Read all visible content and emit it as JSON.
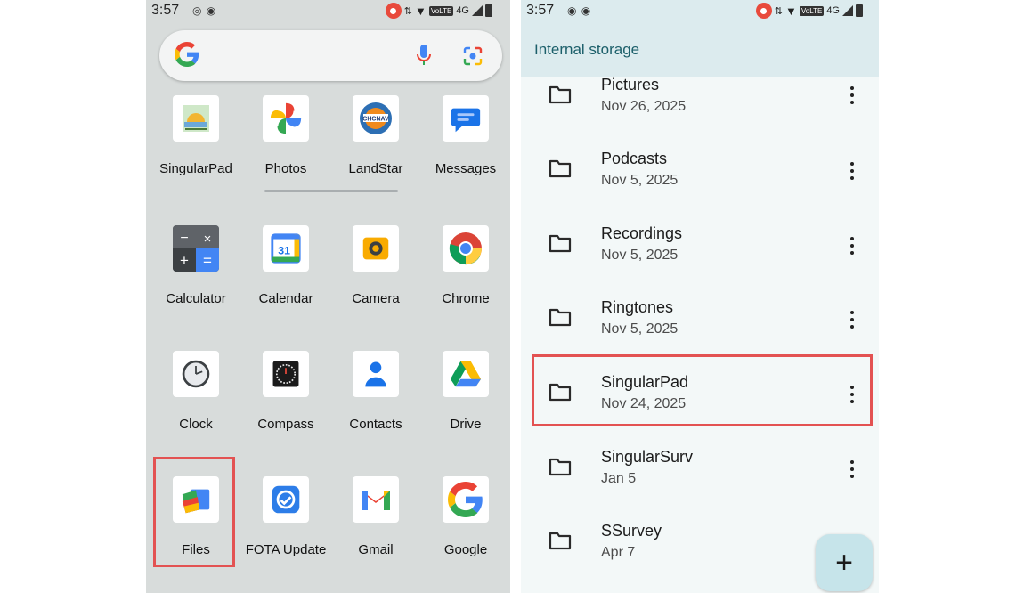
{
  "left_screen": {
    "status_time": "3:57",
    "network": "4G",
    "volte": "VoLTE",
    "apps": [
      {
        "label": "SingularPad",
        "icon": "singularpad-icon"
      },
      {
        "label": "Photos",
        "icon": "photos-icon"
      },
      {
        "label": "LandStar",
        "icon": "landstar-icon"
      },
      {
        "label": "Messages",
        "icon": "messages-icon"
      },
      {
        "label": "Calculator",
        "icon": "calculator-icon"
      },
      {
        "label": "Calendar",
        "icon": "calendar-icon"
      },
      {
        "label": "Camera",
        "icon": "camera-icon"
      },
      {
        "label": "Chrome",
        "icon": "chrome-icon"
      },
      {
        "label": "Clock",
        "icon": "clock-icon"
      },
      {
        "label": "Compass",
        "icon": "compass-icon"
      },
      {
        "label": "Contacts",
        "icon": "contacts-icon"
      },
      {
        "label": "Drive",
        "icon": "drive-icon"
      },
      {
        "label": "Files",
        "icon": "files-icon"
      },
      {
        "label": "FOTA Update",
        "icon": "fota-update-icon"
      },
      {
        "label": "Gmail",
        "icon": "gmail-icon"
      },
      {
        "label": "Google",
        "icon": "google-icon"
      }
    ],
    "calendar_day": "31",
    "landstar_badge": "CHCNAV",
    "highlight_color": "#e35252"
  },
  "right_screen": {
    "status_time": "3:57",
    "network": "4G",
    "volte": "VoLTE",
    "title": "Internal storage",
    "folders": [
      {
        "name": "Pictures",
        "date": "Nov 26, 2025"
      },
      {
        "name": "Podcasts",
        "date": "Nov 5, 2025"
      },
      {
        "name": "Recordings",
        "date": "Nov 5, 2025"
      },
      {
        "name": "Ringtones",
        "date": "Nov 5, 2025"
      },
      {
        "name": "SingularPad",
        "date": "Nov 24, 2025"
      },
      {
        "name": "SingularSurv",
        "date": "Jan 5"
      },
      {
        "name": "SSurvey",
        "date": "Apr 7"
      }
    ],
    "fab_label": "+",
    "highlight_color": "#e35252"
  }
}
